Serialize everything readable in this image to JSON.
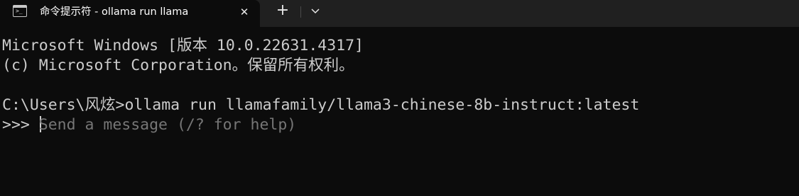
{
  "tab": {
    "title": "命令提示符 - ollama  run llama",
    "close_glyph": "✕",
    "icon": "terminal-icon",
    "icon_glyph": ">_"
  },
  "tabbar": {
    "new_tab_glyph": "+",
    "dropdown_icon": "chevron-down-icon"
  },
  "terminal": {
    "lines": [
      "Microsoft Windows [版本 10.0.22631.4317]",
      "(c) Microsoft Corporation。保留所有权利。",
      "C:\\Users\\风炫>ollama run llamafamily/llama3-chinese-8b-instruct:latest"
    ],
    "prompt": ">>> ",
    "input_placeholder": "Send a message (/? for help)"
  },
  "colors": {
    "background": "#0c0c0c",
    "tabbar": "#202020",
    "text": "#cccccc",
    "placeholder": "#767676"
  }
}
